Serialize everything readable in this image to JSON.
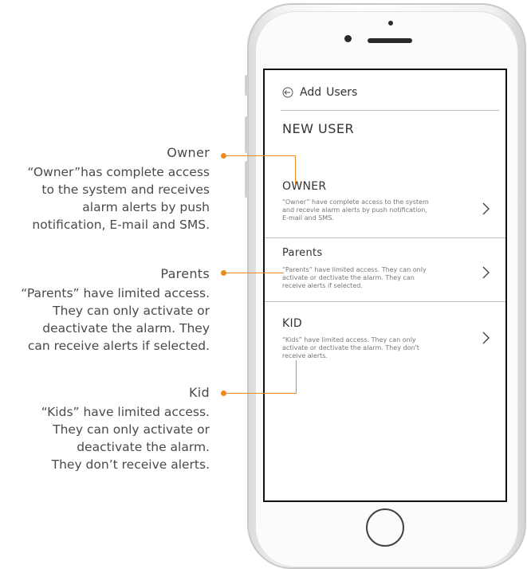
{
  "annotations": {
    "owner": {
      "title": "Owner",
      "lines": [
        "“Owner”has complete access",
        "to the system and receives",
        "alarm alerts by push",
        "notification, E-mail and SMS."
      ]
    },
    "parents": {
      "title": "Parents",
      "lines": [
        "“Parents” have limited access.",
        "They can only activate or",
        "deactivate the alarm. They",
        "can receive alerts if selected."
      ]
    },
    "kid": {
      "title": "Kid",
      "lines": [
        "“Kids” have limited access.",
        "They can only activate or",
        "deactivate the alarm.",
        "They don’t receive alerts."
      ]
    },
    "accent_color": "#ef8a1c"
  },
  "screen": {
    "header": {
      "back_icon": "back-arrow-icon",
      "title_1": "Add",
      "title_2": "Users"
    },
    "section_title": "NEW USER",
    "items": [
      {
        "name": "OWNER",
        "description_lines": [
          "“Owner” have complete access to the system",
          "and recevie alarm alerts by push notification,",
          "E-mail and SMS."
        ],
        "chevron_icon": "chevron-right-icon"
      },
      {
        "name": "Parents",
        "description_lines": [
          "“Parents” have limited access. They can only",
          "activate or dectivate the alarm. They can",
          "receive alerts if selected."
        ],
        "chevron_icon": "chevron-right-icon"
      },
      {
        "name": "KID",
        "description_lines": [
          "“Kids” have limited access. They can only",
          "activate or dectivate the alarm. They don't",
          "receive alerts."
        ],
        "chevron_icon": "chevron-right-icon"
      }
    ]
  }
}
